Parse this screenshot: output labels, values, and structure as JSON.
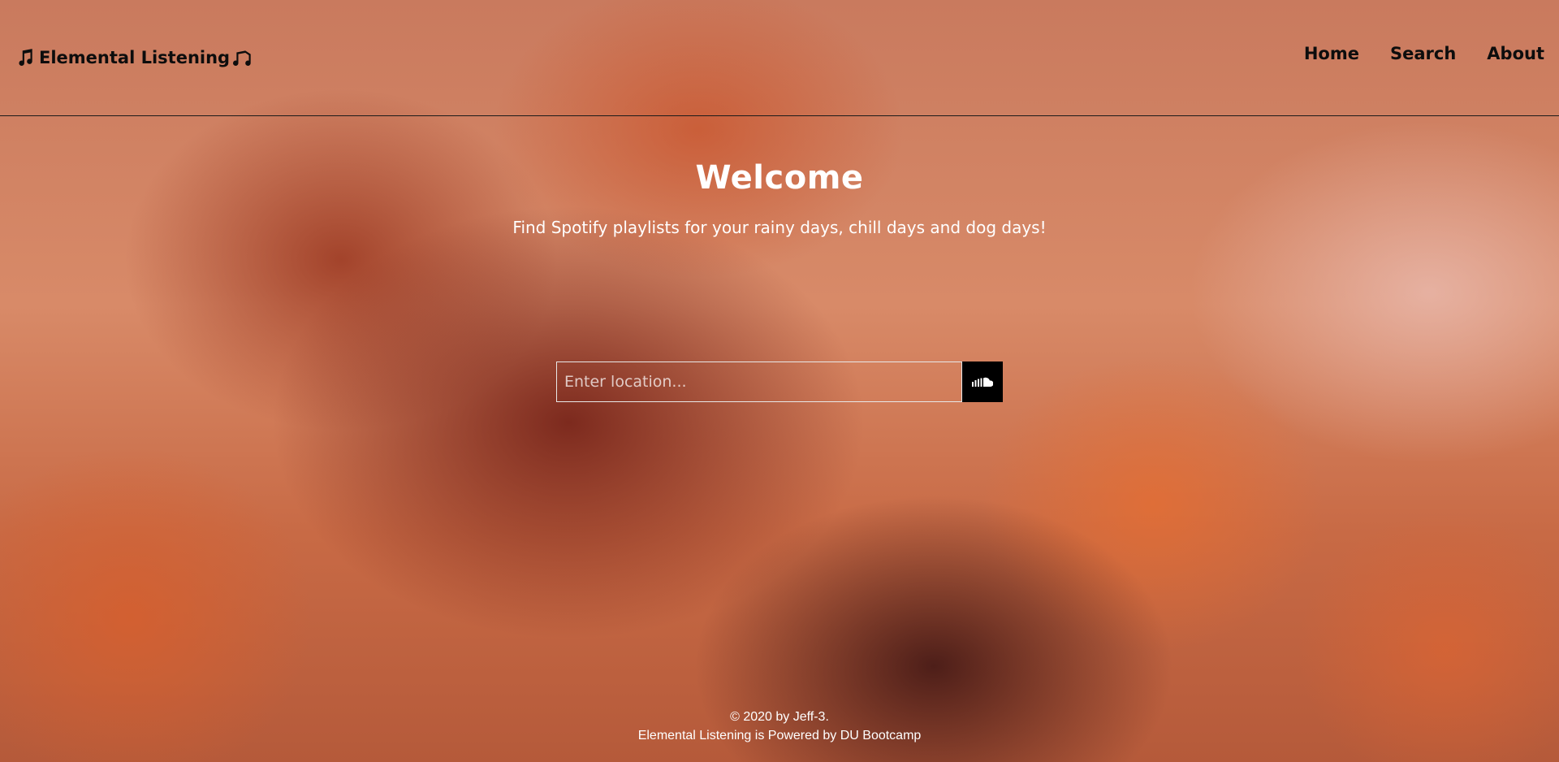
{
  "header": {
    "brand": "Elemental Listening",
    "left_icon": "music-note-icon",
    "right_icon": "music-note-icon",
    "nav": {
      "home": "Home",
      "search": "Search",
      "about": "About"
    }
  },
  "hero": {
    "title": "Welcome",
    "subtitle": "Find Spotify playlists for your rainy days, chill days and dog days!"
  },
  "search": {
    "placeholder": "Enter location...",
    "value": "",
    "button_icon": "soundcloud-icon"
  },
  "footer": {
    "copyright": "© 2020 by Jeff-3.",
    "powered": "Elemental Listening is Powered by DU Bootcamp"
  },
  "colors": {
    "text_dark": "#0d0d0d",
    "text_light": "#ffffff",
    "button_bg": "#000000"
  }
}
